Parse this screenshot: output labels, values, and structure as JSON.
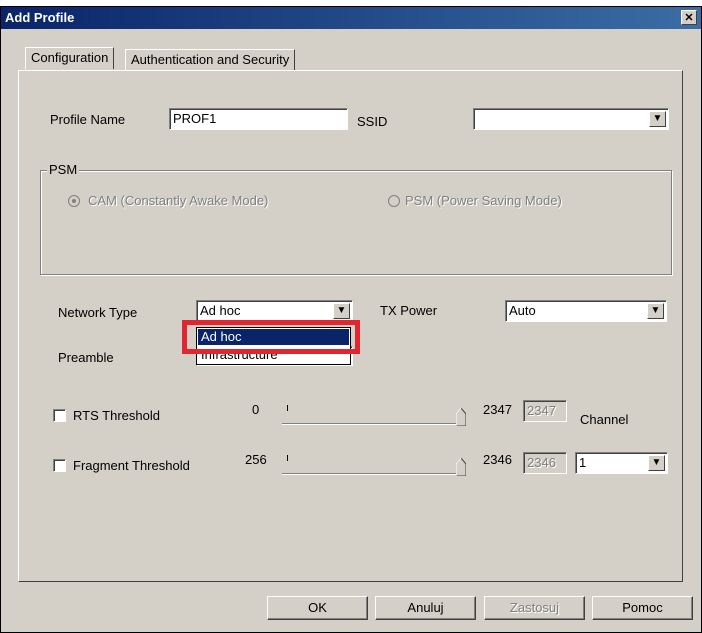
{
  "window": {
    "title": "Add Profile"
  },
  "tabs": [
    {
      "label": "Configuration"
    },
    {
      "label": "Authentication and Security"
    }
  ],
  "profile": {
    "name_label": "Profile Name",
    "name_value": "PROF1",
    "ssid_label": "SSID",
    "ssid_value": ""
  },
  "psm": {
    "group_label": "PSM",
    "cam_label": "CAM (Constantly Awake Mode)",
    "psm_label": "PSM (Power Saving Mode)",
    "selected": "CAM (Constantly Awake Mode)"
  },
  "network": {
    "type_label": "Network Type",
    "type_value": "Ad hoc",
    "type_options": [
      "Ad hoc",
      "Infrastructure"
    ],
    "tx_label": "TX Power",
    "tx_value": "Auto",
    "preamble_label": "Preamble"
  },
  "rts": {
    "label": "RTS Threshold",
    "min": "0",
    "max": "2347",
    "value": "2347",
    "checked": false
  },
  "fragment": {
    "label": "Fragment Threshold",
    "min": "256",
    "max": "2346",
    "value": "2346",
    "checked": false
  },
  "channel": {
    "label": "Channel",
    "value": "1"
  },
  "buttons": {
    "ok": "OK",
    "cancel": "Anuluj",
    "apply": "Zastosuj",
    "help": "Pomoc"
  },
  "icons": {
    "close": "close-icon",
    "dropdown": "chevron-down-icon"
  },
  "colors": {
    "titlebar": "#0a246a",
    "dialog_bg": "#d4d0c8",
    "highlight": "#e0262e"
  }
}
